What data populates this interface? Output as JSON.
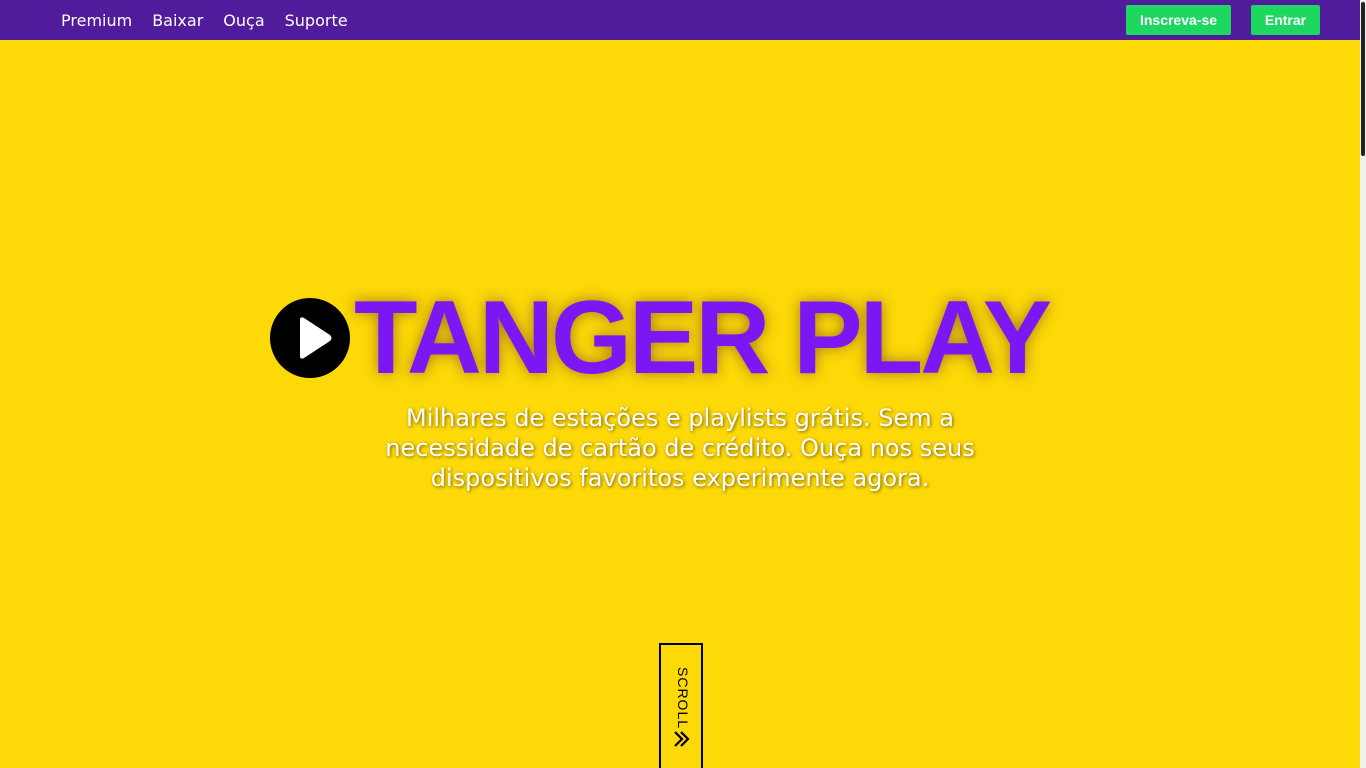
{
  "navbar": {
    "links": [
      {
        "label": "Premium"
      },
      {
        "label": "Baixar"
      },
      {
        "label": "Ouça"
      },
      {
        "label": "Suporte"
      }
    ],
    "signup_label": "Inscreva-se",
    "login_label": "Entrar"
  },
  "hero": {
    "title": "TANGER PLAY",
    "subtitle": "Milhares de estações e playlists grátis. Sem a necessidade de cartão de crédito. Ouça nos seus dispositivos favoritos experimente agora.",
    "logo_icon": "play-icon"
  },
  "scroll": {
    "label": "SCROLL",
    "icon": "double-chevron-down-icon"
  },
  "colors": {
    "navbar_bg": "#511c9c",
    "page_bg": "#fdd907",
    "title": "#7a17f3",
    "button_bg": "#1ed760"
  }
}
